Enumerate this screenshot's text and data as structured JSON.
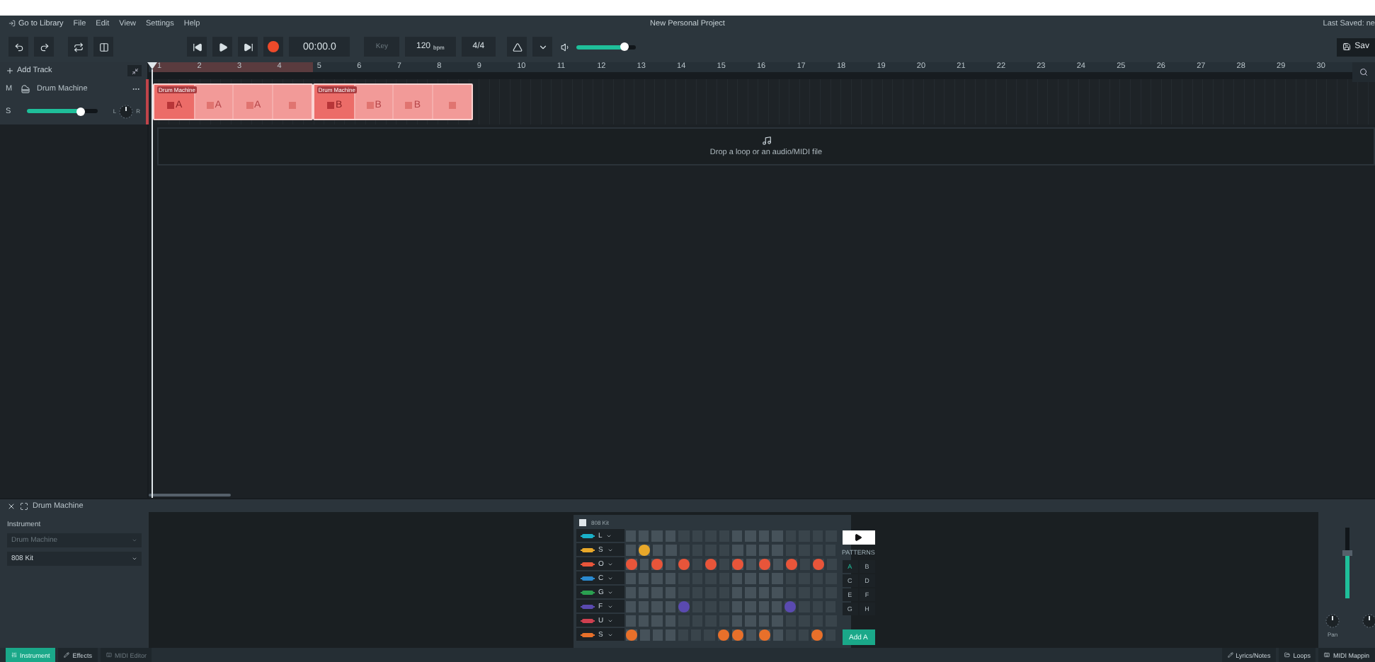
{
  "menu_bar": {
    "library_link": "Go to Library",
    "menus": [
      "File",
      "Edit",
      "View",
      "Settings",
      "Help"
    ],
    "project_title": "New Personal Project",
    "last_saved": "Last Saved: ne"
  },
  "toolbar": {
    "time": "00:00.0",
    "key": "Key",
    "tempo": "120",
    "tempo_unit": "bpm",
    "signature": "4/4",
    "volume": {
      "level": 0.8
    },
    "save": "Sav"
  },
  "add_track": "Add Track",
  "ruler": {
    "bars": [
      "1",
      "2",
      "3",
      "4",
      "5",
      "6",
      "7",
      "8",
      "9",
      "10",
      "11",
      "12",
      "13",
      "14",
      "15",
      "16",
      "17",
      "18",
      "19",
      "20",
      "21",
      "22",
      "23",
      "24",
      "25",
      "26",
      "27",
      "28",
      "29",
      "30"
    ]
  },
  "tracks": [
    {
      "name": "Drum Machine",
      "mute": "M",
      "solo": "S",
      "volume": {
        "level": 0.75
      },
      "pan_left": "L",
      "pan_right": "R",
      "clips": [
        {
          "title": "Drum Machine",
          "segments": [
            {
              "label": "A",
              "active": true
            },
            {
              "label": "A",
              "active": false
            },
            {
              "label": "A",
              "active": false
            },
            {
              "active": false
            }
          ]
        },
        {
          "title": "Drum Machine",
          "segments": [
            {
              "label": "B",
              "active": true
            },
            {
              "label": "B",
              "active": false
            },
            {
              "label": "B",
              "active": false
            },
            {
              "active": false
            }
          ]
        }
      ]
    }
  ],
  "drop_zone": {
    "text": "Drop a loop or an audio/MIDI file"
  },
  "bottom_panel": {
    "title": "Drum Machine",
    "instrument_label": "Instrument",
    "instrument_select": {
      "value": "Drum Machine",
      "disabled": true
    },
    "kit_select": {
      "value": "808 Kit",
      "disabled": false
    },
    "drum_machine": {
      "title": "808 Kit",
      "patterns_label": "PATTERNS",
      "patterns": [
        {
          "label": "A",
          "selected": true
        },
        {
          "label": "B",
          "selected": false
        },
        {
          "label": "C",
          "selected": false
        },
        {
          "label": "D",
          "selected": false
        },
        {
          "label": "E",
          "selected": false
        },
        {
          "label": "F",
          "selected": false
        },
        {
          "label": "G",
          "selected": false
        },
        {
          "label": "H",
          "selected": false
        }
      ],
      "add_button": "Add A",
      "rows": [
        {
          "label": "L",
          "color": "#1ab0c8",
          "steps": [
            false,
            false,
            false,
            false,
            false,
            false,
            false,
            false,
            false,
            false,
            false,
            false,
            false,
            false,
            false,
            false
          ]
        },
        {
          "label": "S",
          "color": "#e8a82a",
          "steps": [
            false,
            true,
            false,
            false,
            false,
            false,
            false,
            false,
            false,
            false,
            false,
            false,
            false,
            false,
            false,
            false
          ]
        },
        {
          "label": "O",
          "color": "#e8553a",
          "steps": [
            true,
            false,
            true,
            false,
            true,
            false,
            true,
            false,
            true,
            false,
            true,
            false,
            true,
            false,
            true,
            false
          ]
        },
        {
          "label": "C",
          "color": "#2a8ad0",
          "steps": [
            false,
            false,
            false,
            false,
            false,
            false,
            false,
            false,
            false,
            false,
            false,
            false,
            false,
            false,
            false,
            false
          ]
        },
        {
          "label": "G",
          "color": "#2aa050",
          "steps": [
            false,
            false,
            false,
            false,
            false,
            false,
            false,
            false,
            false,
            false,
            false,
            false,
            false,
            false,
            false,
            false
          ]
        },
        {
          "label": "F",
          "color": "#5a4ab0",
          "steps": [
            false,
            false,
            false,
            false,
            true,
            false,
            false,
            false,
            false,
            false,
            false,
            false,
            true,
            false,
            false,
            false
          ]
        },
        {
          "label": "U",
          "color": "#d04050",
          "steps": [
            false,
            false,
            false,
            false,
            false,
            false,
            false,
            false,
            false,
            false,
            false,
            false,
            false,
            false,
            false,
            false
          ]
        },
        {
          "label": "S",
          "color": "#e8702a",
          "steps": [
            true,
            false,
            false,
            false,
            false,
            false,
            false,
            true,
            true,
            false,
            true,
            false,
            false,
            false,
            true,
            false
          ]
        }
      ]
    },
    "mixer": {
      "fader": {
        "level": 0.65
      },
      "pan_label": "Pan"
    }
  },
  "bottom_tabs": [
    {
      "label": "Instrument",
      "selected": true,
      "disabled": false
    },
    {
      "label": "Effects",
      "selected": false,
      "disabled": false
    },
    {
      "label": "MIDI Editor",
      "selected": false,
      "disabled": true
    }
  ],
  "bottom_right_buttons": [
    "Lyrics/Notes",
    "Loops",
    "MIDI Mappin"
  ]
}
